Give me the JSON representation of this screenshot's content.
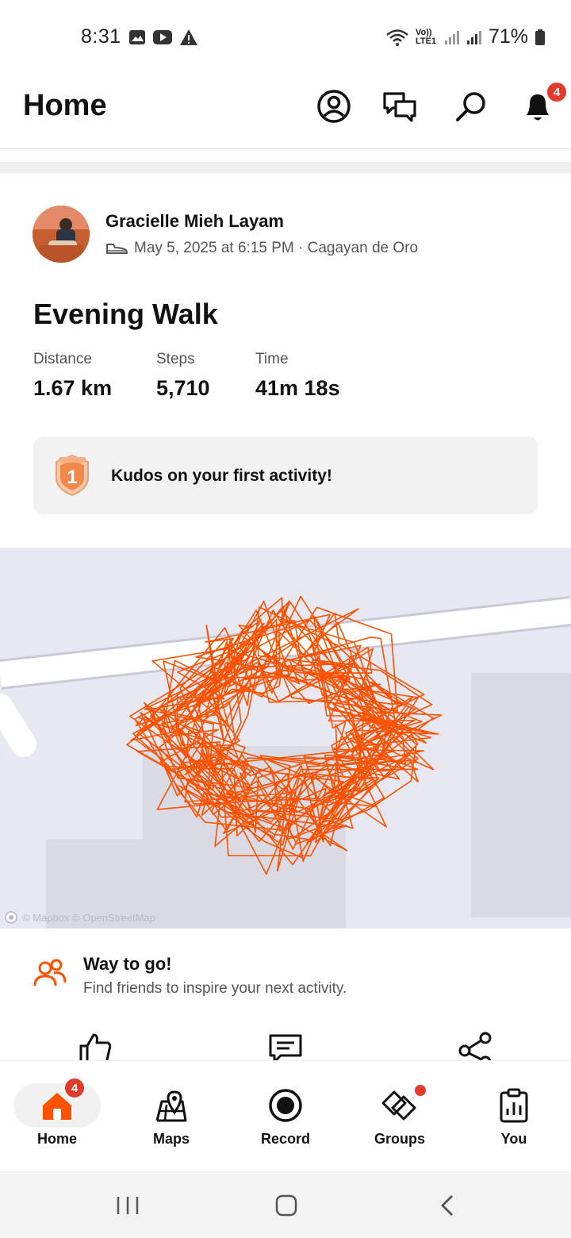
{
  "status_bar": {
    "time": "8:31",
    "battery": "71%",
    "network": "Vo)) LTE1"
  },
  "header": {
    "title": "Home",
    "notification_count": "4"
  },
  "activity": {
    "athlete": "Gracielle Mieh Layam",
    "datetime_location": "May 5, 2025 at 6:15 PM · Cagayan de Oro",
    "title": "Evening Walk",
    "stats": [
      {
        "label": "Distance",
        "value": "1.67 km"
      },
      {
        "label": "Steps",
        "value": "5,710"
      },
      {
        "label": "Time",
        "value": "41m 18s"
      }
    ],
    "kudos_text": "Kudos on your first activity!",
    "kudos_badge_number": "1"
  },
  "map": {
    "attribution": "© Mapbox © OpenStreetMap",
    "route_color": "#fc5200"
  },
  "suggestion": {
    "title": "Way to go!",
    "subtitle": "Find friends to inspire your next activity."
  },
  "bottom_nav": {
    "home": "Home",
    "home_badge": "4",
    "maps": "Maps",
    "record": "Record",
    "groups": "Groups",
    "you": "You"
  },
  "colors": {
    "accent": "#fc5200",
    "badge": "#e33b2b"
  }
}
